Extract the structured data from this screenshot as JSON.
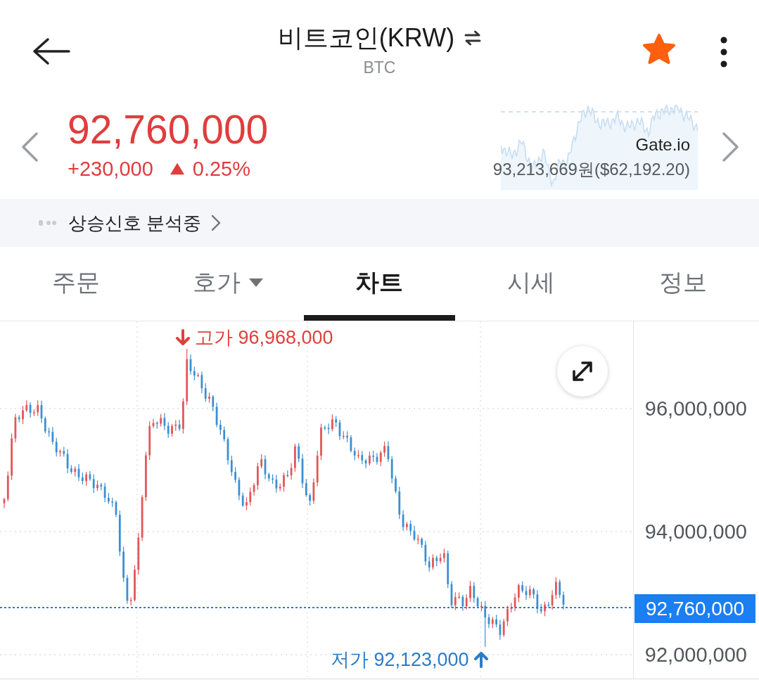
{
  "header": {
    "title": "비트코인(KRW)",
    "subtitle": "BTC",
    "favorite": true
  },
  "quote": {
    "price": "92,760,000",
    "change": "+230,000",
    "change_rate": "0.25%",
    "rising": true,
    "exchange": {
      "name": "Gate.io",
      "price": "93,213,669원($62,192.20)"
    }
  },
  "signal_banner": {
    "text": "상승신호 분석중"
  },
  "tabs": [
    {
      "label": "주문",
      "selected": false,
      "dropdown": false
    },
    {
      "label": "호가",
      "selected": false,
      "dropdown": true
    },
    {
      "label": "차트",
      "selected": true,
      "dropdown": false
    },
    {
      "label": "시세",
      "selected": false,
      "dropdown": false
    },
    {
      "label": "정보",
      "selected": false,
      "dropdown": false
    }
  ],
  "chart": {
    "high_marker": "고가 96,968,000",
    "low_marker": "저가 92,123,000",
    "y_axis_labels": [
      "96,000,000",
      "94,000,000",
      "92,000,000"
    ],
    "current_price_tag": "92,760,000"
  }
}
